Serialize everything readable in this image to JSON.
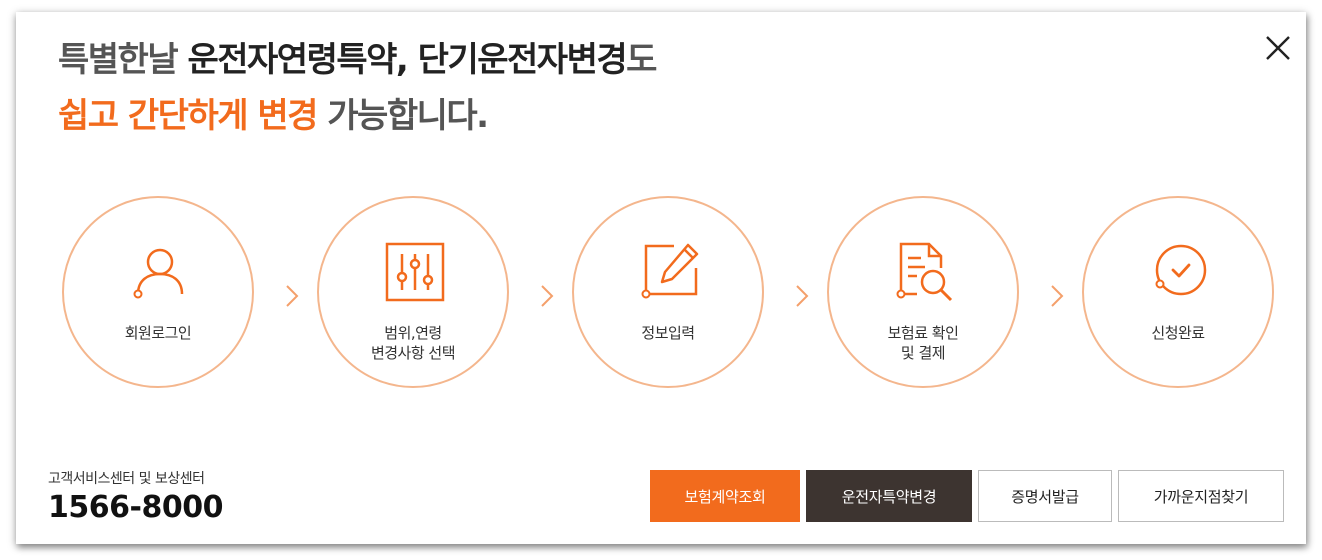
{
  "headline": {
    "line1_pre": "특별한날 ",
    "line1_bold": "운전자연령특약, 단기운전자변경",
    "line1_post": "도",
    "line2_accent": "쉽고 간단하게 변경",
    "line2_post": " 가능합니다."
  },
  "colors": {
    "accent": "#f26b1d",
    "dark": "#3d3430",
    "circle_border": "#f4b68d"
  },
  "steps": [
    {
      "icon": "user-icon",
      "label_lines": [
        "회원로그인"
      ]
    },
    {
      "icon": "sliders-icon",
      "label_lines": [
        "범위,연령",
        "변경사항 선택"
      ]
    },
    {
      "icon": "edit-icon",
      "label_lines": [
        "정보입력"
      ]
    },
    {
      "icon": "document-search-icon",
      "label_lines": [
        "보험료 확인",
        "및 결제"
      ]
    },
    {
      "icon": "check-circle-icon",
      "label_lines": [
        "신청완료"
      ]
    }
  ],
  "customer_service": {
    "title": "고객서비스센터 및 보상센터",
    "phone": "1566-8000"
  },
  "buttons": {
    "contract": "보험계약조회",
    "driver_change": "운전자특약변경",
    "certificate": "증명서발급",
    "branch": "가까운지점찾기"
  },
  "icons": {
    "close": "close-icon",
    "arrow": "chevron-right-icon"
  }
}
